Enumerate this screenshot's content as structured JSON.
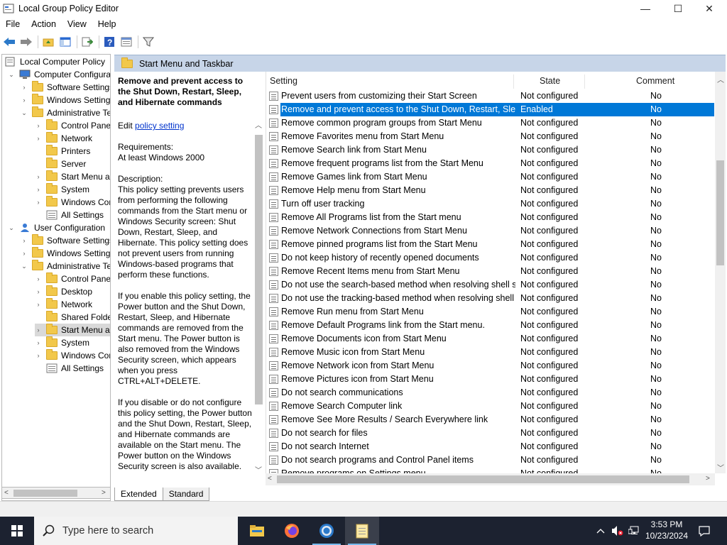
{
  "window": {
    "title": "Local Group Policy Editor",
    "controls": {
      "minimize": "—",
      "maximize": "☐",
      "close": "✕"
    }
  },
  "menu": [
    "File",
    "Action",
    "View",
    "Help"
  ],
  "tree": [
    {
      "label": "Local Computer Policy",
      "level": 0,
      "expander": "",
      "icon": "computer-policy-icon"
    },
    {
      "label": "Computer Configura",
      "level": 1,
      "expander": "v",
      "icon": "computer-icon"
    },
    {
      "label": "Software Settings",
      "level": 2,
      "expander": ">",
      "icon": "folder-icon"
    },
    {
      "label": "Windows Setting",
      "level": 2,
      "expander": ">",
      "icon": "folder-icon"
    },
    {
      "label": "Administrative Te",
      "level": 2,
      "expander": "v",
      "icon": "folder-icon"
    },
    {
      "label": "Control Panel",
      "level": 3,
      "expander": ">",
      "icon": "folder-icon"
    },
    {
      "label": "Network",
      "level": 3,
      "expander": ">",
      "icon": "folder-icon"
    },
    {
      "label": "Printers",
      "level": 3,
      "expander": "",
      "icon": "folder-icon"
    },
    {
      "label": "Server",
      "level": 3,
      "expander": "",
      "icon": "folder-icon"
    },
    {
      "label": "Start Menu ar",
      "level": 3,
      "expander": ">",
      "icon": "folder-icon"
    },
    {
      "label": "System",
      "level": 3,
      "expander": ">",
      "icon": "folder-icon"
    },
    {
      "label": "Windows Cor",
      "level": 3,
      "expander": ">",
      "icon": "folder-icon"
    },
    {
      "label": "All Settings",
      "level": 3,
      "expander": "",
      "icon": "all-settings-icon"
    },
    {
      "label": "User Configuration",
      "level": 1,
      "expander": "v",
      "icon": "user-icon"
    },
    {
      "label": "Software Settings",
      "level": 2,
      "expander": ">",
      "icon": "folder-icon"
    },
    {
      "label": "Windows Setting",
      "level": 2,
      "expander": ">",
      "icon": "folder-icon"
    },
    {
      "label": "Administrative Te",
      "level": 2,
      "expander": "v",
      "icon": "folder-icon"
    },
    {
      "label": "Control Panel",
      "level": 3,
      "expander": ">",
      "icon": "folder-icon"
    },
    {
      "label": "Desktop",
      "level": 3,
      "expander": ">",
      "icon": "folder-icon"
    },
    {
      "label": "Network",
      "level": 3,
      "expander": ">",
      "icon": "folder-icon"
    },
    {
      "label": "Shared Folder",
      "level": 3,
      "expander": "",
      "icon": "folder-icon"
    },
    {
      "label": "Start Menu ar",
      "level": 3,
      "expander": ">",
      "icon": "folder-icon",
      "selected": true
    },
    {
      "label": "System",
      "level": 3,
      "expander": ">",
      "icon": "folder-icon"
    },
    {
      "label": "Windows Cor",
      "level": 3,
      "expander": ">",
      "icon": "folder-icon"
    },
    {
      "label": "All Settings",
      "level": 3,
      "expander": "",
      "icon": "all-settings-icon"
    }
  ],
  "band": {
    "title": "Start Menu and Taskbar"
  },
  "description": {
    "title": "Remove and prevent access to the Shut Down, Restart, Sleep, and Hibernate commands",
    "edit_prefix": "Edit",
    "edit_link": "policy setting",
    "requirements_label": "Requirements:",
    "requirements_value": "At least Windows 2000",
    "description_label": "Description:",
    "paragraph1": "This policy setting prevents users from performing the following commands from the Start menu or Windows Security screen: Shut Down, Restart, Sleep, and Hibernate. This policy setting does not prevent users from running Windows-based programs that perform these functions.",
    "paragraph2": "If you enable this policy setting, the Power button and the Shut Down, Restart, Sleep, and Hibernate commands are removed from the Start menu. The Power button is also removed from the Windows Security screen, which appears when you press CTRL+ALT+DELETE.",
    "paragraph3": "If you disable or do not configure this policy setting, the Power button and the Shut Down, Restart, Sleep, and Hibernate commands are available on the Start menu. The Power button on the Windows Security screen is also available."
  },
  "list": {
    "headers": {
      "setting": "Setting",
      "state": "State",
      "comment": "Comment"
    },
    "rows": [
      {
        "name": "Prevent users from customizing their Start Screen",
        "state": "Not configured",
        "comment": "No"
      },
      {
        "name": "Remove and prevent access to the Shut Down, Restart, Sleep...",
        "state": "Enabled",
        "comment": "No",
        "selected": true
      },
      {
        "name": "Remove common program groups from Start Menu",
        "state": "Not configured",
        "comment": "No"
      },
      {
        "name": "Remove Favorites menu from Start Menu",
        "state": "Not configured",
        "comment": "No"
      },
      {
        "name": "Remove Search link from Start Menu",
        "state": "Not configured",
        "comment": "No"
      },
      {
        "name": "Remove frequent programs list from the Start Menu",
        "state": "Not configured",
        "comment": "No"
      },
      {
        "name": "Remove Games link from Start Menu",
        "state": "Not configured",
        "comment": "No"
      },
      {
        "name": "Remove Help menu from Start Menu",
        "state": "Not configured",
        "comment": "No"
      },
      {
        "name": "Turn off user tracking",
        "state": "Not configured",
        "comment": "No"
      },
      {
        "name": "Remove All Programs list from the Start menu",
        "state": "Not configured",
        "comment": "No"
      },
      {
        "name": "Remove Network Connections from Start Menu",
        "state": "Not configured",
        "comment": "No"
      },
      {
        "name": "Remove pinned programs list from the Start Menu",
        "state": "Not configured",
        "comment": "No"
      },
      {
        "name": "Do not keep history of recently opened documents",
        "state": "Not configured",
        "comment": "No"
      },
      {
        "name": "Remove Recent Items menu from Start Menu",
        "state": "Not configured",
        "comment": "No"
      },
      {
        "name": "Do not use the search-based method when resolving shell s...",
        "state": "Not configured",
        "comment": "No"
      },
      {
        "name": "Do not use the tracking-based method when resolving shell ...",
        "state": "Not configured",
        "comment": "No"
      },
      {
        "name": "Remove Run menu from Start Menu",
        "state": "Not configured",
        "comment": "No"
      },
      {
        "name": "Remove Default Programs link from the Start menu.",
        "state": "Not configured",
        "comment": "No"
      },
      {
        "name": "Remove Documents icon from Start Menu",
        "state": "Not configured",
        "comment": "No"
      },
      {
        "name": "Remove Music icon from Start Menu",
        "state": "Not configured",
        "comment": "No"
      },
      {
        "name": "Remove Network icon from Start Menu",
        "state": "Not configured",
        "comment": "No"
      },
      {
        "name": "Remove Pictures icon from Start Menu",
        "state": "Not configured",
        "comment": "No"
      },
      {
        "name": "Do not search communications",
        "state": "Not configured",
        "comment": "No"
      },
      {
        "name": "Remove Search Computer link",
        "state": "Not configured",
        "comment": "No"
      },
      {
        "name": "Remove See More Results / Search Everywhere link",
        "state": "Not configured",
        "comment": "No"
      },
      {
        "name": "Do not search for files",
        "state": "Not configured",
        "comment": "No"
      },
      {
        "name": "Do not search Internet",
        "state": "Not configured",
        "comment": "No"
      },
      {
        "name": "Do not search programs and Control Panel items",
        "state": "Not configured",
        "comment": "No"
      },
      {
        "name": "Remove programs on Settings menu",
        "state": "Not configured",
        "comment": "No"
      }
    ]
  },
  "tabs": [
    "Extended",
    "Standard"
  ],
  "taskbar": {
    "search_placeholder": "Type here to search",
    "apps": [
      "file-explorer-icon",
      "firefox-icon",
      "chrome-icon",
      "notepad-icon"
    ],
    "time": "3:53 PM",
    "date": "10/23/2024"
  },
  "colors": {
    "selection": "#0078d7",
    "band": "#c7d5e8",
    "taskbar": "#1c2230",
    "link": "#0033cc"
  }
}
